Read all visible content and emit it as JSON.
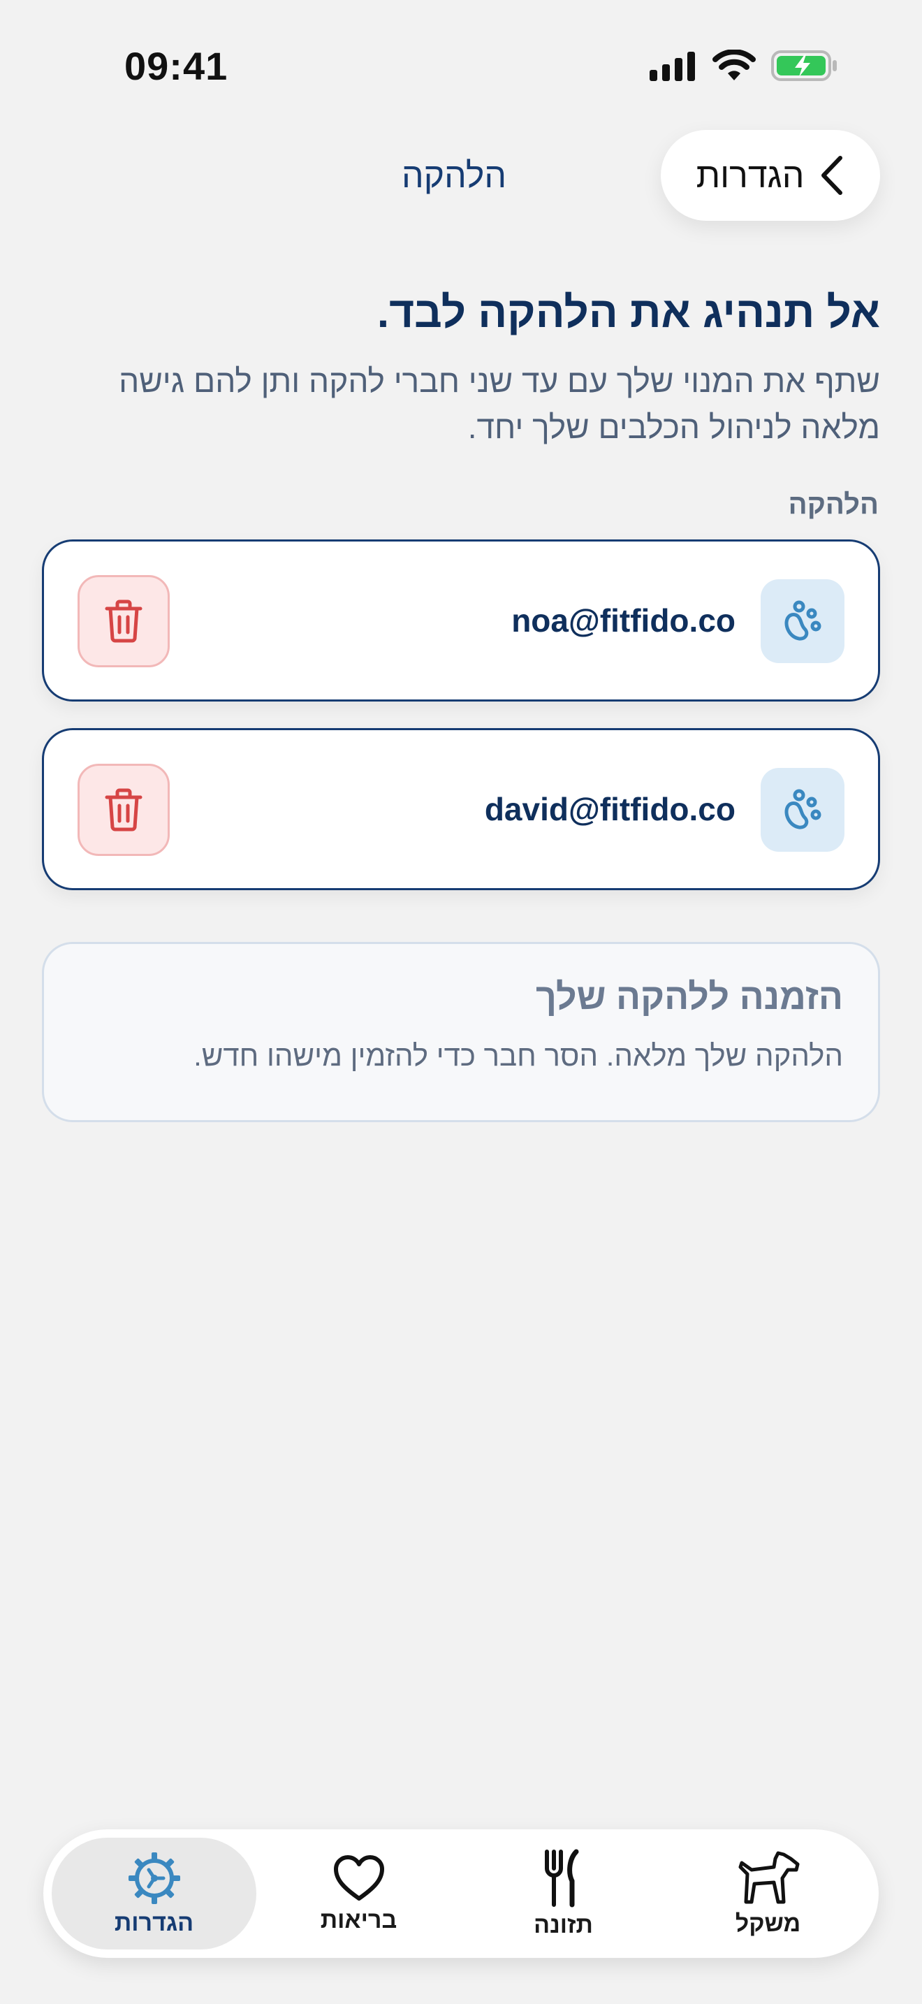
{
  "status_bar": {
    "time": "09:41"
  },
  "nav": {
    "back_label": "הגדרות",
    "title": "הלהקה"
  },
  "intro": {
    "heading": "אל תנהיג את הלהקה לבד.",
    "description": "שתף את המנוי שלך עם עד שני חברי להקה ותן להם גישה מלאה לניהול הכלבים שלך יחד."
  },
  "pack": {
    "section_label": "הלהקה",
    "members": [
      {
        "email": "noa@fitfido.co"
      },
      {
        "email": "david@fitfido.co"
      }
    ]
  },
  "invite": {
    "title": "הזמנה ללהקה שלך",
    "text": "הלהקה שלך מלאה. הסר חבר כדי להזמין מישהו חדש."
  },
  "tabs": [
    {
      "label": "הגדרות",
      "icon": "gear-icon",
      "active": true
    },
    {
      "label": "בריאות",
      "icon": "heart-icon",
      "active": false
    },
    {
      "label": "תזונה",
      "icon": "fork-knife-icon",
      "active": false
    },
    {
      "label": "משקל",
      "icon": "dog-icon",
      "active": false
    }
  ],
  "colors": {
    "navy": "#163c73",
    "paw_blue": "#3a88c0",
    "delete_red": "#d64545",
    "background": "#f2f2f2"
  }
}
